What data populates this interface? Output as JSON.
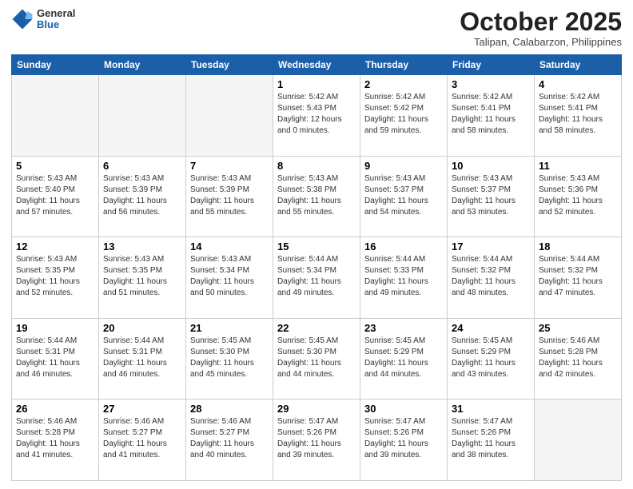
{
  "header": {
    "logo": {
      "general": "General",
      "blue": "Blue"
    },
    "title": "October 2025",
    "subtitle": "Talipan, Calabarzon, Philippines"
  },
  "days_of_week": [
    "Sunday",
    "Monday",
    "Tuesday",
    "Wednesday",
    "Thursday",
    "Friday",
    "Saturday"
  ],
  "weeks": [
    [
      {
        "day": "",
        "info": ""
      },
      {
        "day": "",
        "info": ""
      },
      {
        "day": "",
        "info": ""
      },
      {
        "day": "1",
        "info": "Sunrise: 5:42 AM\nSunset: 5:43 PM\nDaylight: 12 hours\nand 0 minutes."
      },
      {
        "day": "2",
        "info": "Sunrise: 5:42 AM\nSunset: 5:42 PM\nDaylight: 11 hours\nand 59 minutes."
      },
      {
        "day": "3",
        "info": "Sunrise: 5:42 AM\nSunset: 5:41 PM\nDaylight: 11 hours\nand 58 minutes."
      },
      {
        "day": "4",
        "info": "Sunrise: 5:42 AM\nSunset: 5:41 PM\nDaylight: 11 hours\nand 58 minutes."
      }
    ],
    [
      {
        "day": "5",
        "info": "Sunrise: 5:43 AM\nSunset: 5:40 PM\nDaylight: 11 hours\nand 57 minutes."
      },
      {
        "day": "6",
        "info": "Sunrise: 5:43 AM\nSunset: 5:39 PM\nDaylight: 11 hours\nand 56 minutes."
      },
      {
        "day": "7",
        "info": "Sunrise: 5:43 AM\nSunset: 5:39 PM\nDaylight: 11 hours\nand 55 minutes."
      },
      {
        "day": "8",
        "info": "Sunrise: 5:43 AM\nSunset: 5:38 PM\nDaylight: 11 hours\nand 55 minutes."
      },
      {
        "day": "9",
        "info": "Sunrise: 5:43 AM\nSunset: 5:37 PM\nDaylight: 11 hours\nand 54 minutes."
      },
      {
        "day": "10",
        "info": "Sunrise: 5:43 AM\nSunset: 5:37 PM\nDaylight: 11 hours\nand 53 minutes."
      },
      {
        "day": "11",
        "info": "Sunrise: 5:43 AM\nSunset: 5:36 PM\nDaylight: 11 hours\nand 52 minutes."
      }
    ],
    [
      {
        "day": "12",
        "info": "Sunrise: 5:43 AM\nSunset: 5:35 PM\nDaylight: 11 hours\nand 52 minutes."
      },
      {
        "day": "13",
        "info": "Sunrise: 5:43 AM\nSunset: 5:35 PM\nDaylight: 11 hours\nand 51 minutes."
      },
      {
        "day": "14",
        "info": "Sunrise: 5:43 AM\nSunset: 5:34 PM\nDaylight: 11 hours\nand 50 minutes."
      },
      {
        "day": "15",
        "info": "Sunrise: 5:44 AM\nSunset: 5:34 PM\nDaylight: 11 hours\nand 49 minutes."
      },
      {
        "day": "16",
        "info": "Sunrise: 5:44 AM\nSunset: 5:33 PM\nDaylight: 11 hours\nand 49 minutes."
      },
      {
        "day": "17",
        "info": "Sunrise: 5:44 AM\nSunset: 5:32 PM\nDaylight: 11 hours\nand 48 minutes."
      },
      {
        "day": "18",
        "info": "Sunrise: 5:44 AM\nSunset: 5:32 PM\nDaylight: 11 hours\nand 47 minutes."
      }
    ],
    [
      {
        "day": "19",
        "info": "Sunrise: 5:44 AM\nSunset: 5:31 PM\nDaylight: 11 hours\nand 46 minutes."
      },
      {
        "day": "20",
        "info": "Sunrise: 5:44 AM\nSunset: 5:31 PM\nDaylight: 11 hours\nand 46 minutes."
      },
      {
        "day": "21",
        "info": "Sunrise: 5:45 AM\nSunset: 5:30 PM\nDaylight: 11 hours\nand 45 minutes."
      },
      {
        "day": "22",
        "info": "Sunrise: 5:45 AM\nSunset: 5:30 PM\nDaylight: 11 hours\nand 44 minutes."
      },
      {
        "day": "23",
        "info": "Sunrise: 5:45 AM\nSunset: 5:29 PM\nDaylight: 11 hours\nand 44 minutes."
      },
      {
        "day": "24",
        "info": "Sunrise: 5:45 AM\nSunset: 5:29 PM\nDaylight: 11 hours\nand 43 minutes."
      },
      {
        "day": "25",
        "info": "Sunrise: 5:46 AM\nSunset: 5:28 PM\nDaylight: 11 hours\nand 42 minutes."
      }
    ],
    [
      {
        "day": "26",
        "info": "Sunrise: 5:46 AM\nSunset: 5:28 PM\nDaylight: 11 hours\nand 41 minutes."
      },
      {
        "day": "27",
        "info": "Sunrise: 5:46 AM\nSunset: 5:27 PM\nDaylight: 11 hours\nand 41 minutes."
      },
      {
        "day": "28",
        "info": "Sunrise: 5:46 AM\nSunset: 5:27 PM\nDaylight: 11 hours\nand 40 minutes."
      },
      {
        "day": "29",
        "info": "Sunrise: 5:47 AM\nSunset: 5:26 PM\nDaylight: 11 hours\nand 39 minutes."
      },
      {
        "day": "30",
        "info": "Sunrise: 5:47 AM\nSunset: 5:26 PM\nDaylight: 11 hours\nand 39 minutes."
      },
      {
        "day": "31",
        "info": "Sunrise: 5:47 AM\nSunset: 5:26 PM\nDaylight: 11 hours\nand 38 minutes."
      },
      {
        "day": "",
        "info": ""
      }
    ]
  ]
}
